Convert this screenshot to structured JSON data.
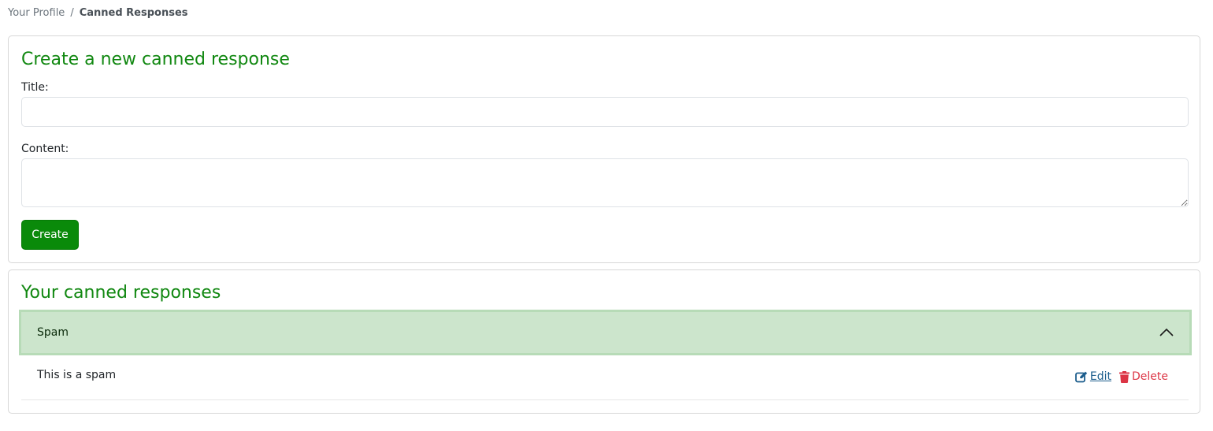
{
  "breadcrumb": {
    "parent": "Your Profile",
    "separator": "/",
    "current": "Canned Responses"
  },
  "create_form": {
    "heading": "Create a new canned response",
    "title_label": "Title:",
    "title_value": "",
    "content_label": "Content:",
    "content_value": "",
    "submit_label": "Create"
  },
  "list": {
    "heading": "Your canned responses",
    "items": [
      {
        "title": "Spam",
        "expanded": true,
        "content": "This is a spam",
        "edit_label": "Edit",
        "delete_label": "Delete"
      }
    ]
  },
  "icons": {
    "chevron": "chevron-up-icon",
    "edit": "edit-icon",
    "delete": "trash-icon"
  },
  "colors": {
    "accent": "#118811",
    "button_bg": "#0a8a0a",
    "accordion_bg": "#cce5cc",
    "edit_link": "#1d5e8d",
    "delete_link": "#dc3545"
  }
}
